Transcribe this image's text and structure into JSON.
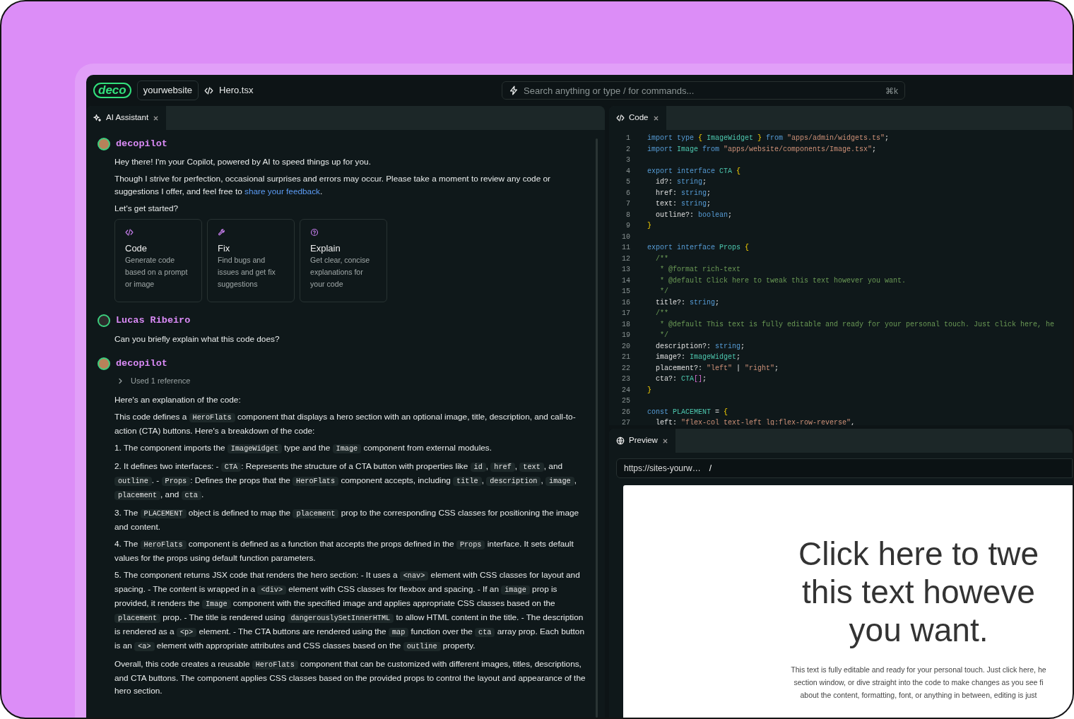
{
  "header": {
    "logo": "deco",
    "site": "yourwebsite",
    "file": "Hero.tsx",
    "search": {
      "placeholder": "Search anything or type / for commands...",
      "shortcut": "⌘k"
    }
  },
  "assistant_panel": {
    "tabs": [
      {
        "label": "AI Assistant",
        "selected": true
      }
    ],
    "messages": [
      {
        "kind": "bot",
        "author": "decopilot",
        "blocks": [
          {
            "kind": "paragraph",
            "parts": [
              {
                "kind": "plain",
                "text": "Hey there! I'm your Copilot, powered by AI to speed things up for you."
              }
            ]
          },
          {
            "kind": "paragraph",
            "parts": [
              {
                "kind": "plain",
                "text": "Though I strive for perfection, occasional surprises and errors may occur. Please take a moment to review any code or suggestions I offer, and feel free to "
              },
              {
                "kind": "link",
                "text": "share your feedback"
              },
              {
                "kind": "plain",
                "text": "."
              }
            ]
          },
          {
            "kind": "paragraph",
            "parts": [
              {
                "kind": "plain",
                "text": "Let's get started?"
              }
            ]
          },
          {
            "kind": "cards",
            "items": [
              {
                "title": "Code",
                "text": "Generate code based on a prompt or image"
              },
              {
                "title": "Fix",
                "text": "Find bugs and issues and get fix suggestions"
              },
              {
                "title": "Explain",
                "text": "Get clear, concise explanations for your code"
              }
            ]
          }
        ]
      },
      {
        "kind": "user",
        "author": "Lucas Ribeiro",
        "blocks": [
          {
            "kind": "paragraph",
            "parts": [
              {
                "kind": "plain",
                "text": "Can you briefly explain what this code does?"
              }
            ]
          }
        ]
      },
      {
        "kind": "bot",
        "author": "decopilot",
        "blocks": [
          {
            "kind": "reference",
            "label": "Used 1 reference",
            "expanded": false
          },
          {
            "kind": "paragraph",
            "parts": [
              {
                "kind": "plain",
                "text": "Here's an explanation of the code:"
              }
            ]
          },
          {
            "kind": "paragraph",
            "parts": [
              {
                "kind": "plain",
                "text": "This code defines a "
              },
              {
                "kind": "code",
                "text": "HeroFlats"
              },
              {
                "kind": "plain",
                "text": " component that displays a hero section with an optional image, title, description, and call-to-action (CTA) buttons. Here's a breakdown of the code:"
              }
            ]
          },
          {
            "kind": "paragraph",
            "parts": [
              {
                "kind": "plain",
                "text": "1. The component imports the "
              },
              {
                "kind": "code",
                "text": "ImageWidget"
              },
              {
                "kind": "plain",
                "text": " type and the "
              },
              {
                "kind": "code",
                "text": "Image"
              },
              {
                "kind": "plain",
                "text": " component from external modules."
              }
            ]
          },
          {
            "kind": "paragraph",
            "parts": [
              {
                "kind": "plain",
                "text": "2. It defines two interfaces: - "
              },
              {
                "kind": "code",
                "text": "CTA"
              },
              {
                "kind": "plain",
                "text": ": Represents the structure of a CTA button with properties like "
              },
              {
                "kind": "code",
                "text": "id"
              },
              {
                "kind": "plain",
                "text": ", "
              },
              {
                "kind": "code",
                "text": "href"
              },
              {
                "kind": "plain",
                "text": ", "
              },
              {
                "kind": "code",
                "text": "text"
              },
              {
                "kind": "plain",
                "text": ", and "
              },
              {
                "kind": "code",
                "text": "outline"
              },
              {
                "kind": "plain",
                "text": ". - "
              },
              {
                "kind": "code",
                "text": "Props"
              },
              {
                "kind": "plain",
                "text": ": Defines the props that the "
              },
              {
                "kind": "code",
                "text": "HeroFlats"
              },
              {
                "kind": "plain",
                "text": " component accepts, including "
              },
              {
                "kind": "code",
                "text": "title"
              },
              {
                "kind": "plain",
                "text": ", "
              },
              {
                "kind": "code",
                "text": "description"
              },
              {
                "kind": "plain",
                "text": ", "
              },
              {
                "kind": "code",
                "text": "image"
              },
              {
                "kind": "plain",
                "text": ", "
              },
              {
                "kind": "code",
                "text": "placement"
              },
              {
                "kind": "plain",
                "text": ", and "
              },
              {
                "kind": "code",
                "text": "cta"
              },
              {
                "kind": "plain",
                "text": "."
              }
            ]
          },
          {
            "kind": "paragraph",
            "parts": [
              {
                "kind": "plain",
                "text": "3. The "
              },
              {
                "kind": "code",
                "text": "PLACEMENT"
              },
              {
                "kind": "plain",
                "text": " object is defined to map the "
              },
              {
                "kind": "code",
                "text": "placement"
              },
              {
                "kind": "plain",
                "text": " prop to the corresponding CSS classes for positioning the image and content."
              }
            ]
          },
          {
            "kind": "paragraph",
            "parts": [
              {
                "kind": "plain",
                "text": "4. The "
              },
              {
                "kind": "code",
                "text": "HeroFlats"
              },
              {
                "kind": "plain",
                "text": " component is defined as a function that accepts the props defined in the "
              },
              {
                "kind": "code",
                "text": "Props"
              },
              {
                "kind": "plain",
                "text": " interface. It sets default values for the props using default function parameters."
              }
            ]
          },
          {
            "kind": "paragraph",
            "parts": [
              {
                "kind": "plain",
                "text": "5. The component returns JSX code that renders the hero section: - It uses a "
              },
              {
                "kind": "code",
                "text": "<nav>"
              },
              {
                "kind": "plain",
                "text": " element with CSS classes for layout and spacing. - The content is wrapped in a "
              },
              {
                "kind": "code",
                "text": "<div>"
              },
              {
                "kind": "plain",
                "text": " element with CSS classes for flexbox and spacing. - If an "
              },
              {
                "kind": "code",
                "text": "image"
              },
              {
                "kind": "plain",
                "text": " prop is provided, it renders the "
              },
              {
                "kind": "code",
                "text": "Image"
              },
              {
                "kind": "plain",
                "text": " component with the specified image and applies appropriate CSS classes based on the "
              },
              {
                "kind": "code",
                "text": "placement"
              },
              {
                "kind": "plain",
                "text": " prop. - The title is rendered using "
              },
              {
                "kind": "code",
                "text": "dangerouslySetInnerHTML"
              },
              {
                "kind": "plain",
                "text": " to allow HTML content in the title. - The description is rendered as a "
              },
              {
                "kind": "code",
                "text": "<p>"
              },
              {
                "kind": "plain",
                "text": " element. - The CTA buttons are rendered using the "
              },
              {
                "kind": "code",
                "text": "map"
              },
              {
                "kind": "plain",
                "text": " function over the "
              },
              {
                "kind": "code",
                "text": "cta"
              },
              {
                "kind": "plain",
                "text": " array prop. Each button is an "
              },
              {
                "kind": "code",
                "text": "<a>"
              },
              {
                "kind": "plain",
                "text": " element with appropriate attributes and CSS classes based on the "
              },
              {
                "kind": "code",
                "text": "outline"
              },
              {
                "kind": "plain",
                "text": " property."
              }
            ]
          },
          {
            "kind": "paragraph",
            "parts": [
              {
                "kind": "plain",
                "text": "Overall, this code creates a reusable "
              },
              {
                "kind": "code",
                "text": "HeroFlats"
              },
              {
                "kind": "plain",
                "text": " component that can be customized with different images, titles, descriptions, and CTA buttons. The component applies CSS classes based on the provided props to control the layout and appearance of the hero section."
              }
            ]
          }
        ]
      }
    ]
  },
  "code_panel": {
    "tabs": [
      {
        "label": "Code",
        "selected": true
      }
    ],
    "lines": [
      {
        "n": "1",
        "tokens": [
          {
            "kind": "keyword",
            "text": "import type "
          },
          {
            "kind": "brace",
            "text": "{ "
          },
          {
            "kind": "type",
            "text": "ImageWidget "
          },
          {
            "kind": "brace",
            "text": "} "
          },
          {
            "kind": "keyword",
            "text": "from "
          },
          {
            "kind": "string",
            "text": "\"apps/admin/widgets.ts\""
          },
          {
            "kind": "plain",
            "text": ";"
          }
        ]
      },
      {
        "n": "2",
        "tokens": [
          {
            "kind": "keyword",
            "text": "import "
          },
          {
            "kind": "type",
            "text": "Image "
          },
          {
            "kind": "keyword",
            "text": "from "
          },
          {
            "kind": "string",
            "text": "\"apps/website/components/Image.tsx\""
          },
          {
            "kind": "plain",
            "text": ";"
          }
        ]
      },
      {
        "n": "3"
      },
      {
        "n": "4",
        "tokens": [
          {
            "kind": "keyword",
            "text": "export interface "
          },
          {
            "kind": "type",
            "text": "CTA "
          },
          {
            "kind": "brace",
            "text": "{"
          }
        ]
      },
      {
        "n": "5",
        "tokens": [
          {
            "kind": "plain",
            "text": "  id?: "
          },
          {
            "kind": "keyword",
            "text": "string"
          },
          {
            "kind": "plain",
            "text": ";"
          }
        ]
      },
      {
        "n": "6",
        "tokens": [
          {
            "kind": "plain",
            "text": "  href: "
          },
          {
            "kind": "keyword",
            "text": "string"
          },
          {
            "kind": "plain",
            "text": ";"
          }
        ]
      },
      {
        "n": "7",
        "tokens": [
          {
            "kind": "plain",
            "text": "  text: "
          },
          {
            "kind": "keyword",
            "text": "string"
          },
          {
            "kind": "plain",
            "text": ";"
          }
        ]
      },
      {
        "n": "8",
        "tokens": [
          {
            "kind": "plain",
            "text": "  outline?: "
          },
          {
            "kind": "keyword",
            "text": "boolean"
          },
          {
            "kind": "plain",
            "text": ";"
          }
        ]
      },
      {
        "n": "9",
        "tokens": [
          {
            "kind": "brace",
            "text": "}"
          }
        ]
      },
      {
        "n": "10"
      },
      {
        "n": "11",
        "tokens": [
          {
            "kind": "keyword",
            "text": "export interface "
          },
          {
            "kind": "type",
            "text": "Props "
          },
          {
            "kind": "brace",
            "text": "{"
          }
        ]
      },
      {
        "n": "12",
        "tokens": [
          {
            "kind": "comment",
            "text": "  /**"
          }
        ]
      },
      {
        "n": "13",
        "tokens": [
          {
            "kind": "comment",
            "text": "   * @format rich-text"
          }
        ]
      },
      {
        "n": "14",
        "tokens": [
          {
            "kind": "comment",
            "text": "   * @default Click here to tweak this text however you want."
          }
        ]
      },
      {
        "n": "15",
        "tokens": [
          {
            "kind": "comment",
            "text": "   */"
          }
        ]
      },
      {
        "n": "16",
        "tokens": [
          {
            "kind": "plain",
            "text": "  title?: "
          },
          {
            "kind": "keyword",
            "text": "string"
          },
          {
            "kind": "plain",
            "text": ";"
          }
        ]
      },
      {
        "n": "17",
        "tokens": [
          {
            "kind": "comment",
            "text": "  /**"
          }
        ]
      },
      {
        "n": "18",
        "tokens": [
          {
            "kind": "comment",
            "text": "   * @default This text is fully editable and ready for your personal touch. Just click here, he"
          }
        ]
      },
      {
        "n": "19",
        "tokens": [
          {
            "kind": "comment",
            "text": "   */"
          }
        ]
      },
      {
        "n": "20",
        "tokens": [
          {
            "kind": "plain",
            "text": "  description?: "
          },
          {
            "kind": "keyword",
            "text": "string"
          },
          {
            "kind": "plain",
            "text": ";"
          }
        ]
      },
      {
        "n": "21",
        "tokens": [
          {
            "kind": "plain",
            "text": "  image?: "
          },
          {
            "kind": "type",
            "text": "ImageWidget"
          },
          {
            "kind": "plain",
            "text": ";"
          }
        ]
      },
      {
        "n": "22",
        "tokens": [
          {
            "kind": "plain",
            "text": "  placement?: "
          },
          {
            "kind": "string",
            "text": "\"left\""
          },
          {
            "kind": "plain",
            "text": " | "
          },
          {
            "kind": "string",
            "text": "\"right\""
          },
          {
            "kind": "plain",
            "text": ";"
          }
        ]
      },
      {
        "n": "23",
        "tokens": [
          {
            "kind": "plain",
            "text": "  cta?: "
          },
          {
            "kind": "type",
            "text": "CTA"
          },
          {
            "kind": "bracket",
            "text": "[]"
          },
          {
            "kind": "plain",
            "text": ";"
          }
        ]
      },
      {
        "n": "24",
        "tokens": [
          {
            "kind": "brace",
            "text": "}"
          }
        ]
      },
      {
        "n": "25"
      },
      {
        "n": "26",
        "tokens": [
          {
            "kind": "keyword",
            "text": "const "
          },
          {
            "kind": "type",
            "text": "PLACEMENT"
          },
          {
            "kind": "plain",
            "text": " = "
          },
          {
            "kind": "brace",
            "text": "{"
          }
        ]
      },
      {
        "n": "27",
        "tokens": [
          {
            "kind": "plain",
            "text": "  left: "
          },
          {
            "kind": "string",
            "text": "\"flex-col text-left lg:flex-row-reverse\""
          },
          {
            "kind": "plain",
            "text": ","
          }
        ]
      }
    ]
  },
  "preview_panel": {
    "tabs": [
      {
        "label": "Preview",
        "selected": true
      }
    ],
    "url": "https://sites-yourw…",
    "path": "/",
    "headline_lines": [
      "Click here to twe",
      "this text howeve",
      "you want."
    ],
    "description_lines": [
      "This text is fully editable and ready for your personal touch. Just click here, he",
      "section window, or dive straight into the code to make changes as you see fi",
      "about the content, formatting, font, or anything in between, editing is just"
    ]
  }
}
